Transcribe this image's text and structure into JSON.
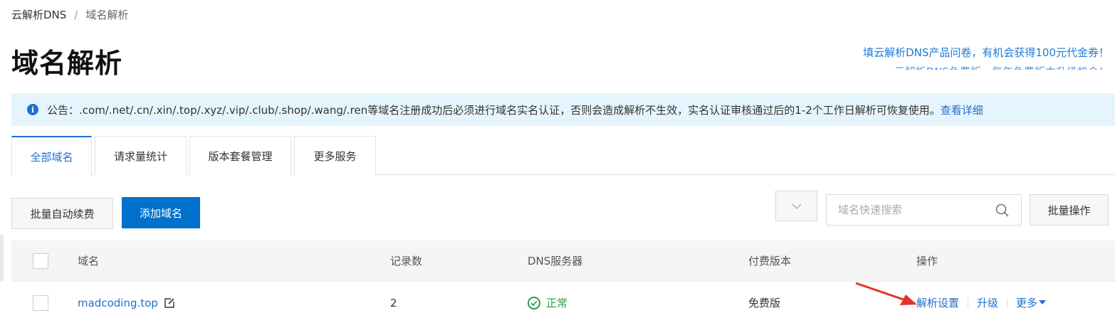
{
  "breadcrumb": {
    "root": "云解析DNS",
    "separator": "/",
    "current": "域名解析"
  },
  "page_title": "域名解析",
  "promo": {
    "line1": "填云解析DNS产品问卷，有机会获得100元代金券！",
    "line2": "云解析DNS免费版，每年免费版本升级机会！"
  },
  "notice": {
    "icon": "info-icon",
    "text": "公告：.com/.net/.cn/.xin/.top/.xyz/.vip/.club/.shop/.wang/.ren等域名注册成功后必须进行域名实名认证，否则会造成解析不生效，实名认证审核通过后的1-2个工作日解析可恢复使用。",
    "link": "查看详细"
  },
  "tabs": [
    {
      "label": "全部域名",
      "active": true
    },
    {
      "label": "请求量统计",
      "active": false
    },
    {
      "label": "版本套餐管理",
      "active": false
    },
    {
      "label": "更多服务",
      "active": false
    }
  ],
  "toolbar": {
    "batch_renew": "批量自动续费",
    "add_domain": "添加域名",
    "search_placeholder": "域名快速搜索",
    "batch_ops": "批量操作"
  },
  "table": {
    "columns": [
      "域名",
      "记录数",
      "DNS服务器",
      "付费版本",
      "操作"
    ],
    "rows": [
      {
        "domain": "madcoding.top",
        "records": "2",
        "dns_status": "正常",
        "plan": "免费版",
        "actions": {
          "resolve": "解析设置",
          "upgrade": "升级",
          "more": "更多"
        }
      }
    ]
  },
  "colors": {
    "accent": "#1e6fd0",
    "primary_button": "#0070cc",
    "ok": "#2a9d4a",
    "notice_bg": "#e6f5fd",
    "annotation_arrow": "#e8312a"
  }
}
